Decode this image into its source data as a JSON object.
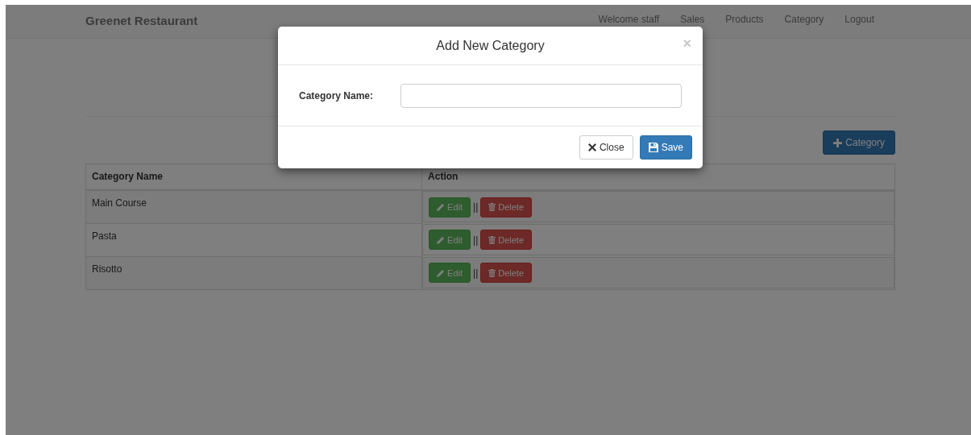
{
  "navbar": {
    "brand": "Greenet Restaurant",
    "welcome": "Welcome staff",
    "links": [
      "Sales",
      "Products",
      "Category",
      "Logout"
    ]
  },
  "add_button": {
    "label": "Category"
  },
  "table": {
    "columns": [
      "Category Name",
      "Action"
    ],
    "rows": [
      {
        "name": "Main Course",
        "edit": "Edit",
        "separator": "||",
        "delete": "Delete"
      },
      {
        "name": "Pasta",
        "edit": "Edit",
        "separator": "||",
        "delete": "Delete"
      },
      {
        "name": "Risotto",
        "edit": "Edit",
        "separator": "||",
        "delete": "Delete"
      }
    ]
  },
  "modal": {
    "title": "Add New Category",
    "close_icon": "×",
    "field_label": "Category Name:",
    "buttons": [
      {
        "kind": "default",
        "label": "Close"
      },
      {
        "kind": "primary",
        "label": "Save"
      }
    ]
  }
}
